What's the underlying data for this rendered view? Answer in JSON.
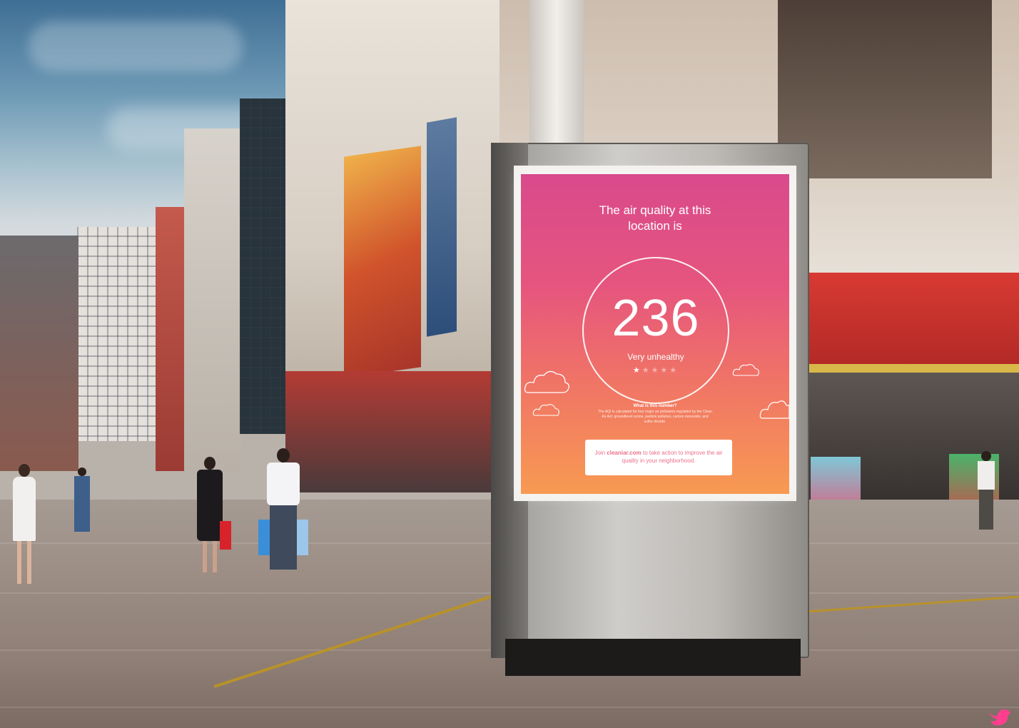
{
  "billboard": {
    "headline": "The air quality at this location is",
    "aqi_value": "236",
    "aqi_label": "Very unhealthy",
    "rating_stars_filled": 1,
    "rating_stars_total": 5,
    "stars_text_on": "★",
    "stars_text_off": "★★★★",
    "info_title": "What is this number?",
    "info_body": "The AQI is calculated for four major air pollutants regulated by the Clean Air Act: groundlevel ozone, particle pollution, carbon monoxide, and sulfur dioxide.",
    "cta_prefix": "Join",
    "cta_link": "cleaniar.com",
    "cta_suffix": "to take action to improve the air quality in your neighborhood."
  },
  "colors": {
    "screen_top": "#d94a8c",
    "screen_bottom": "#f89a52",
    "cta_text": "#ec6f8a",
    "corner_icon": "#ff3f8e"
  },
  "icons": {
    "corner": "bird-icon",
    "clouds": "cloud-icon"
  }
}
